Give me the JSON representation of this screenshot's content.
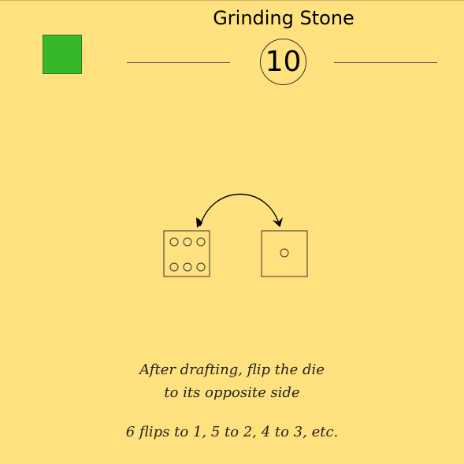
{
  "card": {
    "title": "Grinding Stone",
    "number": "10",
    "swatch_color": "#37b828"
  },
  "illustration": {
    "left_die_face": 6,
    "right_die_face": 1
  },
  "rules": {
    "line1": "After drafting, flip the die",
    "line2": "to its opposite side",
    "line3": "6 flips to 1, 5 to 2, 4 to 3, etc."
  }
}
